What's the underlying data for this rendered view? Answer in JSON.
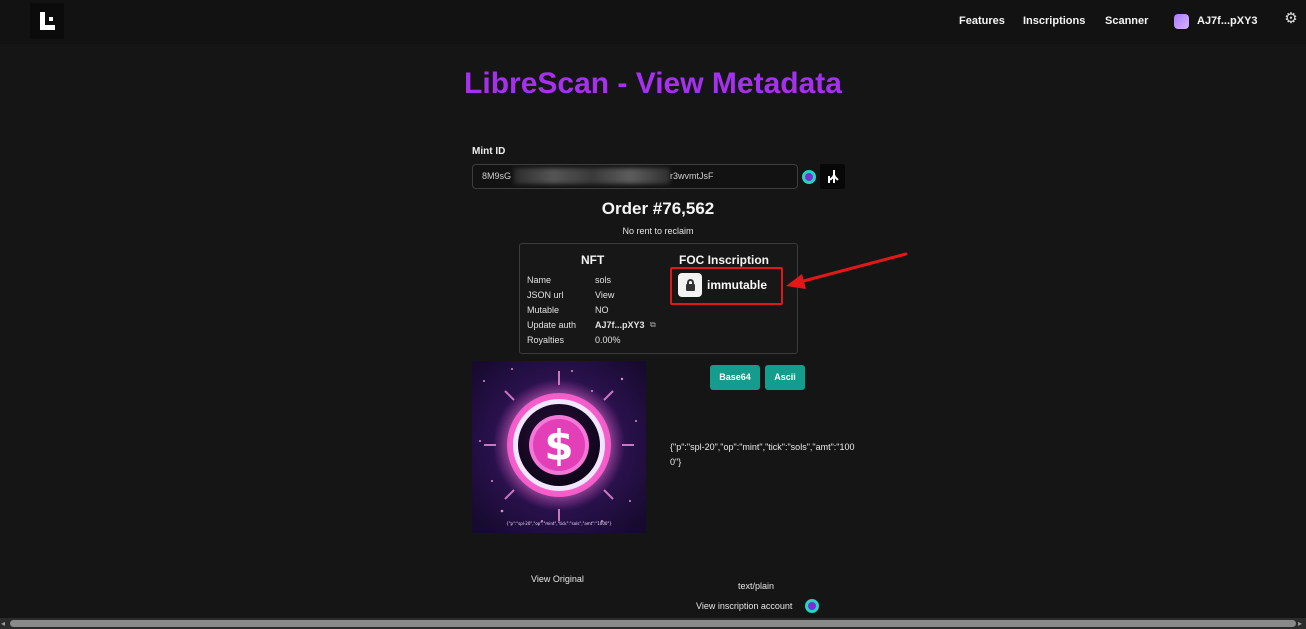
{
  "nav": {
    "features": "Features",
    "inscriptions": "Inscriptions",
    "scanner": "Scanner",
    "wallet": "AJ7f...pXY3"
  },
  "page": {
    "title": "LibreScan - View Metadata",
    "mint_label": "Mint ID",
    "mint_prefix": "8M9sG",
    "mint_suffix": "r3wvmtJsF",
    "order_title": "Order #76,562",
    "rent_note": "No rent to reclaim"
  },
  "nft": {
    "title": "NFT",
    "rows": [
      {
        "key": "Name",
        "value": "sols"
      },
      {
        "key": "JSON url",
        "value": "View"
      },
      {
        "key": "Mutable",
        "value": "NO"
      },
      {
        "key": "Update auth",
        "value": "AJ7f...pXY3"
      },
      {
        "key": "Royalties",
        "value": "0.00%"
      }
    ]
  },
  "foc": {
    "title": "FOC Inscription",
    "status": "immutable"
  },
  "content": {
    "base64_label": "Base64",
    "ascii_label": "Ascii",
    "json_text": "{\"p\":\"spl-20\",\"op\":\"mint\",\"tick\":\"sols\",\"amt\":\"1000\"}",
    "art_caption": "{\"p\":\"spl-20\",\"op\":\"mint\",\"tick\":\"sols\",\"amt\":\"1000\"}",
    "view_original": "View Original",
    "mime_type": "text/plain",
    "view_account": "View inscription account"
  },
  "colors": {
    "accent_purple": "#a531ef",
    "button_teal": "#139d8c",
    "highlight_red": "#e01818",
    "icon_teal": "#27d3c2"
  },
  "icons": {
    "lock": "lock-icon",
    "settings": "gear-icon",
    "arrow": "red-arrow-annotation"
  }
}
